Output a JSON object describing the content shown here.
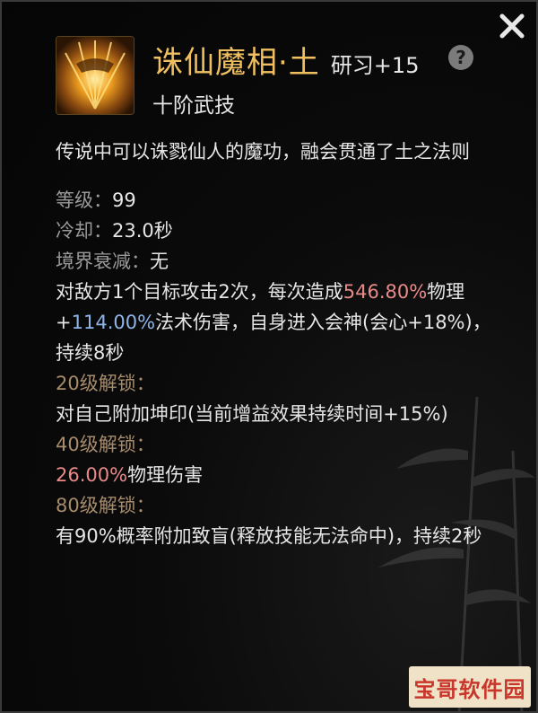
{
  "skill": {
    "name": "诛仙魔相·土",
    "research": "研习+15",
    "tier": "十阶武技",
    "help_symbol": "?",
    "description": "传说中可以诛戮仙人的魔功，融会贯通了土之法则"
  },
  "stats": {
    "level_label": "等级：",
    "level_value": "99",
    "cooldown_label": "冷却：",
    "cooldown_value": "23.0秒",
    "decay_label": "境界衰减：",
    "decay_value": "无"
  },
  "effect": {
    "part1": "对敌方1个目标攻击2次，每次造成",
    "value1": "546.80%",
    "part2": "物理+",
    "value2": "114.00%",
    "part3": "法术伤害，自身进入会神(会心+18%)，持续8秒"
  },
  "unlocks": [
    {
      "label": "20级解锁：",
      "text": "对自己附加坤印(当前增益效果持续时间+15%)"
    },
    {
      "label": "40级解锁：",
      "value": "26.00%",
      "text": "物理伤害"
    },
    {
      "label": "80级解锁：",
      "text": "有90%概率附加致盲(释放技能无法命中)，持续2秒"
    }
  ],
  "icons": {
    "close": "close-icon",
    "skill": "skill-icon",
    "help": "help-icon"
  },
  "colors": {
    "title_gold": "#f0c060",
    "label_gray": "#9a9a9a",
    "unlock_tan": "#a68b6c",
    "highlight_red": "#e88a8a",
    "highlight_blue": "#8fb5e8"
  },
  "watermark": {
    "text": "宝哥软件园"
  }
}
